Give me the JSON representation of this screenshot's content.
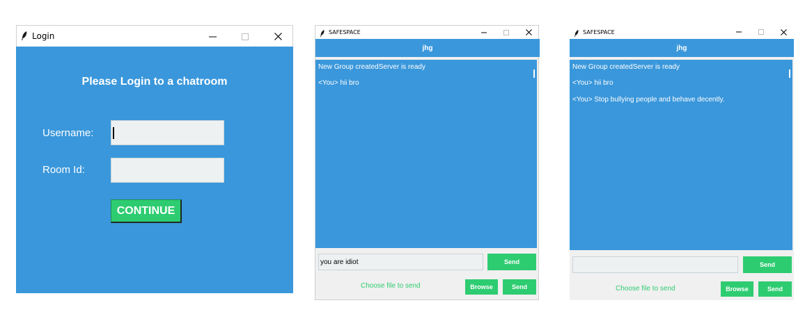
{
  "login": {
    "window_title": "Login",
    "heading": "Please Login to a chatroom",
    "username_label": "Username:",
    "roomid_label": "Room Id:",
    "username_value": "",
    "roomid_value": "",
    "continue_label": "CONTINUE"
  },
  "chat1": {
    "window_title": "SAFESPACE",
    "header": "jhg",
    "messages": [
      "New Group createdServer is ready",
      "<You> hii bro"
    ],
    "input_value": "you are idiot",
    "send_label": "Send",
    "choose_file_label": "Choose file to send",
    "browse_label": "Browse",
    "send_file_label": "Send"
  },
  "chat2": {
    "window_title": "SAFESPACE",
    "header": "jhg",
    "messages": [
      "New Group createdServer is ready",
      "<You> hii bro",
      "<You> Stop bullying people and behave decently."
    ],
    "input_value": "",
    "send_label": "Send",
    "choose_file_label": "Choose file to send",
    "browse_label": "Browse",
    "send_file_label": "Send"
  },
  "colors": {
    "window_bg": "#3a97db",
    "button": "#2ecc71",
    "entry": "#eef1f2"
  },
  "icons": [
    "feather-icon",
    "minimize-icon",
    "maximize-icon",
    "close-icon"
  ]
}
